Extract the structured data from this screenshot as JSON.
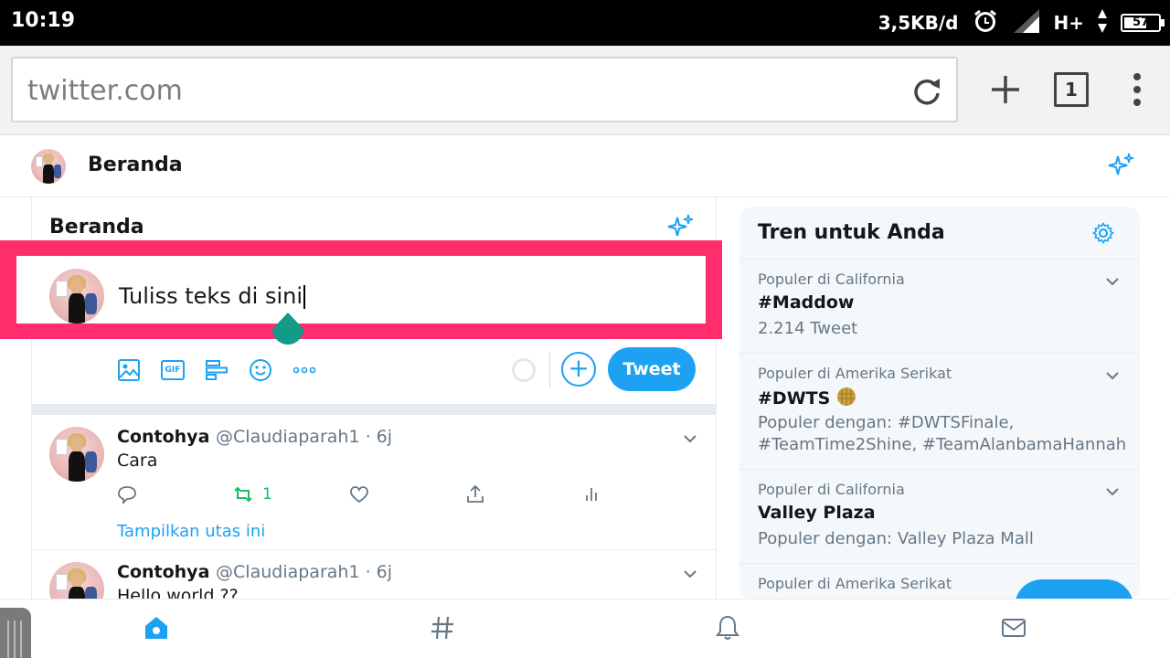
{
  "status_bar": {
    "time": "10:19",
    "net_speed": "3,5KB/d",
    "network": "H+",
    "battery": "57"
  },
  "browser": {
    "url": "twitter.com",
    "tab_count": "1"
  },
  "top_nav": {
    "title": "Beranda"
  },
  "timeline": {
    "header": "Beranda",
    "compose": {
      "text": "Tuliss teks di sini",
      "tweet_button": "Tweet"
    },
    "tweets": [
      {
        "name": "Contohya",
        "handle": "@Claudiaparah1 · 6j",
        "text": "Cara",
        "retweets": "1",
        "show_thread": "Tampilkan utas ini"
      },
      {
        "name": "Contohya",
        "handle": "@Claudiaparah1 · 6j",
        "text": "Hello world ??"
      }
    ]
  },
  "trends": {
    "title": "Tren untuk Anda",
    "items": [
      {
        "context": "Populer di California",
        "name": "#Maddow",
        "meta": "2.214 Tweet"
      },
      {
        "context": "Populer di Amerika Serikat",
        "name": "#DWTS",
        "meta": "Populer dengan: #DWTSFinale, #TeamTime2Shine, #TeamAlanbamaHannah"
      },
      {
        "context": "Populer di California",
        "name": "Valley Plaza",
        "meta": "Populer dengan: Valley Plaza Mall"
      },
      {
        "context": "Populer di Amerika Serikat"
      }
    ]
  },
  "colors": {
    "accent": "#1da1f2",
    "highlight": "#ff2d6b",
    "retweet_green": "#17bf63"
  }
}
